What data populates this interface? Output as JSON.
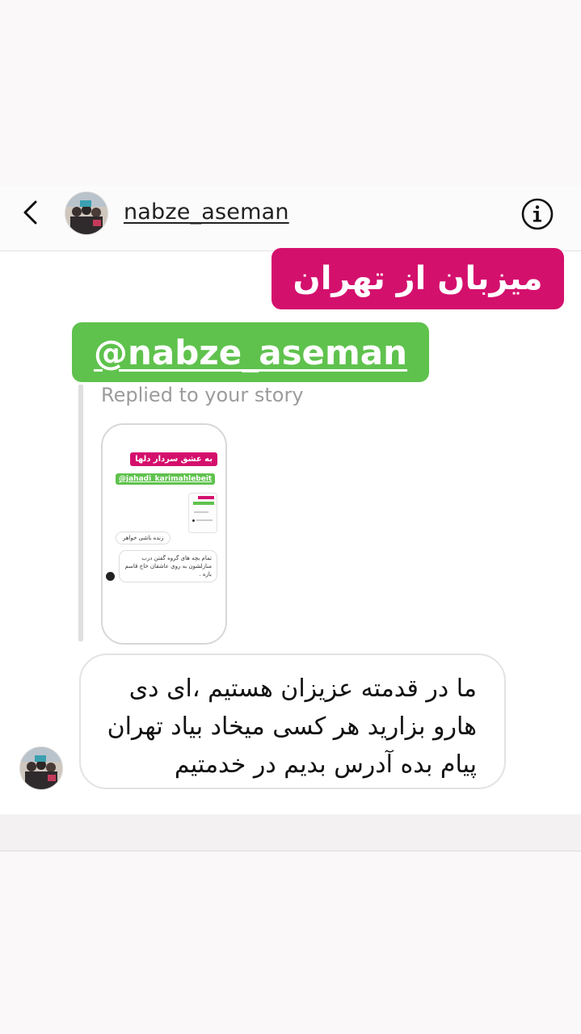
{
  "header": {
    "back_icon": "chevron-left-icon",
    "username": "nabze_aseman",
    "info_icon": "info-icon"
  },
  "story_reply": {
    "pink_tag": "میزبان از تهران",
    "green_tag": "@nabze_aseman",
    "replied_label": "Replied to your story",
    "thumbnail": {
      "pink_tag": "به عشق سردار دلها",
      "green_tag": "@jahadi_karimahlebeit",
      "bubble_1": "زنده باشی خواهر",
      "bubble_2": "تمام بچه های گروه گفتن درب منازلشون به روی عاشقان حاج قاسم بازه ."
    }
  },
  "message": {
    "text": "ما در قدمته عزیزان هستیم ،ای دی هارو بزارید هر کسی میخاد بیاد تهران پیام بده آدرس بدیم در خدمتیم"
  },
  "colors": {
    "pink": "#d4106d",
    "green": "#5fc24d"
  }
}
